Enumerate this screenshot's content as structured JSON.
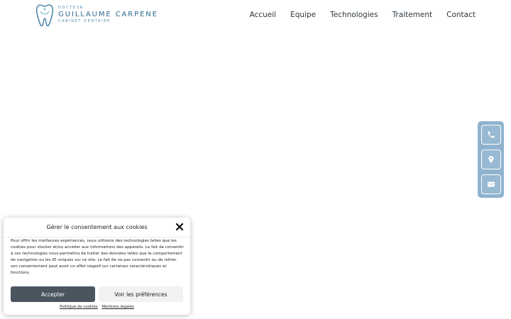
{
  "brand": {
    "small_top": "DOCTEUR",
    "name": "GUILLAUME CARPENE",
    "subtitle": "CABINET DENTAIRE",
    "color": "#2a6a8c"
  },
  "nav": {
    "items": [
      {
        "label": "Accueil"
      },
      {
        "label": "Equipe"
      },
      {
        "label": "Technologies"
      },
      {
        "label": "Traitement"
      },
      {
        "label": "Contact"
      }
    ]
  },
  "floating_contact": {
    "background": "#8fb3ce",
    "buttons": [
      {
        "icon": "phone-icon"
      },
      {
        "icon": "location-pin-icon"
      },
      {
        "icon": "mail-icon"
      }
    ]
  },
  "cookie_banner": {
    "title": "Gérer le consentement aux cookies",
    "body": "Pour offrir les meilleures expériences, nous utilisons des technologies telles que les cookies pour stocker et/ou accéder aux informations des appareils. Le fait de consentir à ces technologies nous permettra de traiter des données telles que le comportement de navigation ou les ID uniques sur ce site. Le fait de ne pas consentir ou de retirer son consentement peut avoir un effet négatif sur certaines caractéristiques et fonctions.",
    "accept_label": "Accepter",
    "preferences_label": "Voir les préférences",
    "links": [
      {
        "label": "Politique de cookies"
      },
      {
        "label": "Mentions légales"
      }
    ],
    "accept_color": "#4a5560"
  }
}
